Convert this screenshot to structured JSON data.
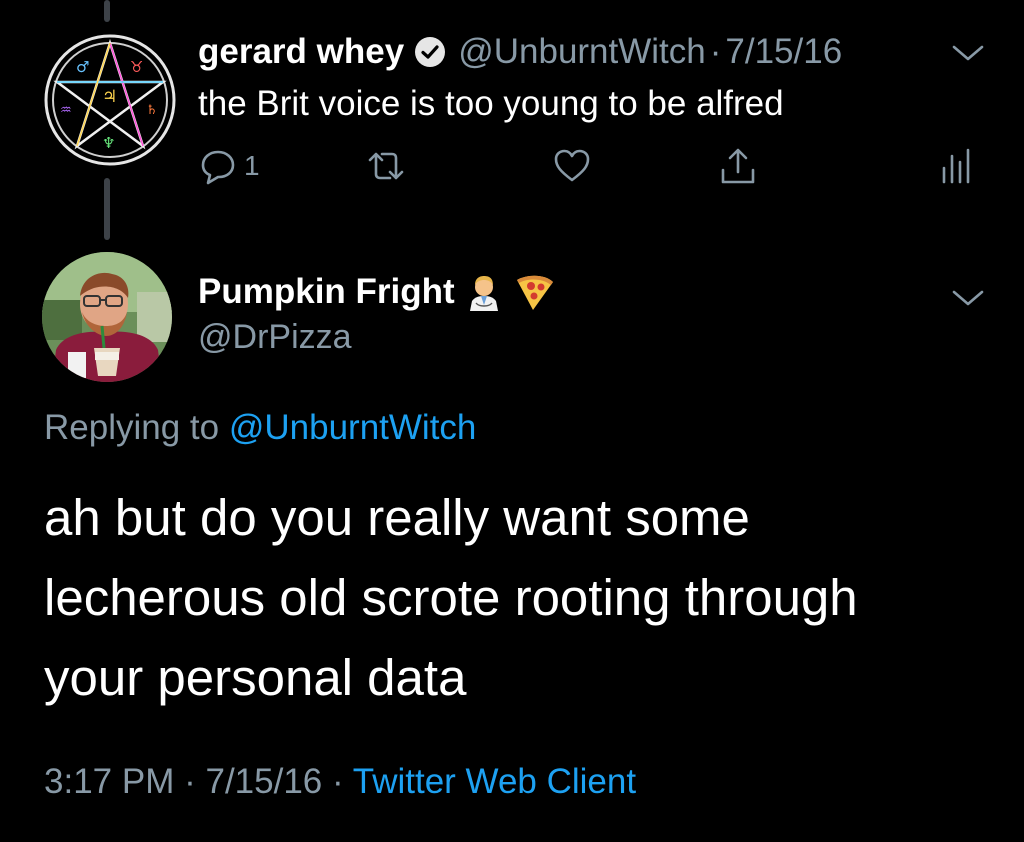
{
  "parent_tweet": {
    "display_name": "gerard whey",
    "handle": "@UnburntWitch",
    "separator": "·",
    "date": "7/15/16",
    "text": "the Brit voice is too young to be alfred",
    "reply_count": "1"
  },
  "reply_tweet": {
    "display_name": "Pumpkin Fright",
    "name_emojis": [
      "doctor-emoji",
      "pizza-emoji"
    ],
    "handle": "@DrPizza",
    "replying_prefix": "Replying to",
    "replying_to": "@UnburntWitch",
    "text_lines": [
      "ah but do you really want some",
      "lecherous old scrote rooting through",
      "your personal data"
    ],
    "time": "3:17 PM",
    "separator": "·",
    "date": "7/15/16",
    "client": "Twitter Web Client"
  },
  "colors": {
    "background": "#000000",
    "text": "#ffffff",
    "secondary": "#8899a6",
    "link": "#1da1f2",
    "thread_line": "#3d4248"
  }
}
